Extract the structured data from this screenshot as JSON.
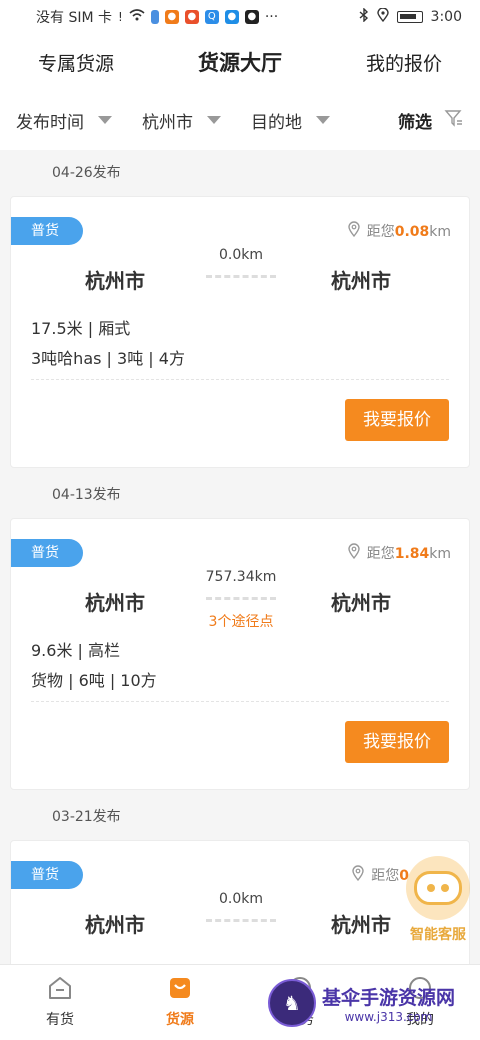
{
  "status_bar": {
    "carrier": "没有 SIM 卡",
    "time": "3:00",
    "dots": "···"
  },
  "top_tabs": [
    {
      "label": "专属货源"
    },
    {
      "label": "货源大厅"
    },
    {
      "label": "我的报价"
    }
  ],
  "filters": {
    "time": "发布时间",
    "city": "杭州市",
    "destination": "目的地",
    "sift": "筛选"
  },
  "listings": [
    {
      "date": "04-26发布",
      "tag": "普货",
      "dist_prefix": "距您",
      "dist_value": "0.08",
      "dist_unit": "km",
      "from_city": "杭州市",
      "to_city": "杭州市",
      "km": "0.0km",
      "waypoints": "",
      "spec1": "17.5米 | 厢式",
      "spec2": "3吨哈has | 3吨 | 4方",
      "button": "我要报价"
    },
    {
      "date": "04-13发布",
      "tag": "普货",
      "dist_prefix": "距您",
      "dist_value": "1.84",
      "dist_unit": "km",
      "from_city": "杭州市",
      "to_city": "杭州市",
      "km": "757.34km",
      "waypoints": "3个途径点",
      "spec1": "9.6米 | 高栏",
      "spec2": "货物 | 6吨 | 10方",
      "button": "我要报价"
    },
    {
      "date": "03-21发布",
      "tag": "普货",
      "dist_prefix": "距您",
      "dist_value": "0",
      "dist_unit": "",
      "from_city": "杭州市",
      "to_city": "杭州市",
      "km": "0.0km",
      "waypoints": "",
      "spec1": "",
      "spec2": "",
      "button": ""
    }
  ],
  "assistant": {
    "label": "智能客服"
  },
  "bottom_nav": [
    {
      "label": "有货"
    },
    {
      "label": "货源"
    },
    {
      "label": "任务"
    },
    {
      "label": "我的"
    }
  ],
  "watermark": {
    "title": "基伞手游资源网",
    "url": "www.j313.com"
  }
}
